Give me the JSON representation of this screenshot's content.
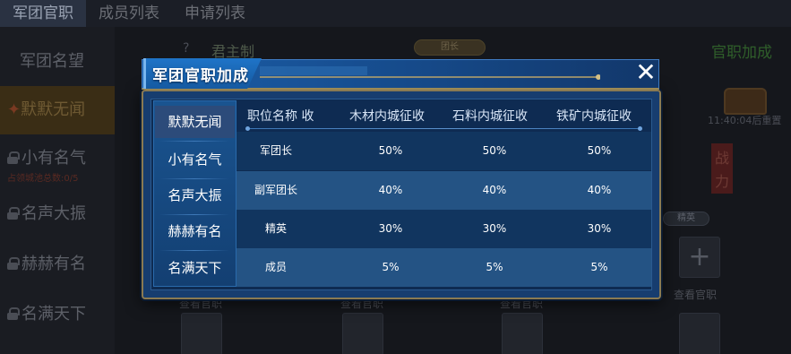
{
  "background": {
    "tabs": [
      "军团官职",
      "成员列表",
      "申请列表"
    ],
    "side_items": [
      {
        "label": "军团名望",
        "sub": ""
      },
      {
        "label": "默默无闻",
        "sub": ""
      },
      {
        "label": "小有名气",
        "sub": "占领城池总数:0/5"
      },
      {
        "label": "名声大振",
        "sub": ""
      },
      {
        "label": "赫赫有名",
        "sub": ""
      },
      {
        "label": "名满天下",
        "sub": ""
      }
    ],
    "leader_label": "君主制",
    "rank_pill": "团长",
    "bonus_title": "官职加成",
    "timer_text": "11:40:04后重置",
    "power_label": "战力",
    "elite_pill": "精英",
    "view_post": "查看官职",
    "view_post_partial": "查看官职"
  },
  "modal": {
    "title": "军团官职加成",
    "close_glyph": "✕",
    "ranks": [
      "默默无闻",
      "小有名气",
      "名声大振",
      "赫赫有名",
      "名满天下"
    ],
    "selected_rank": "默默无闻",
    "table": {
      "headers": [
        "职位名称  收",
        "木材内城征收",
        "石料内城征收",
        "铁矿内城征收"
      ],
      "rows": [
        {
          "position": "军团长",
          "wood": "50%",
          "stone": "50%",
          "iron": "50%"
        },
        {
          "position": "副军团长",
          "wood": "40%",
          "stone": "40%",
          "iron": "40%"
        },
        {
          "position": "精英",
          "wood": "30%",
          "stone": "30%",
          "iron": "30%"
        },
        {
          "position": "成员",
          "wood": "5%",
          "stone": "5%",
          "iron": "5%"
        }
      ]
    }
  }
}
